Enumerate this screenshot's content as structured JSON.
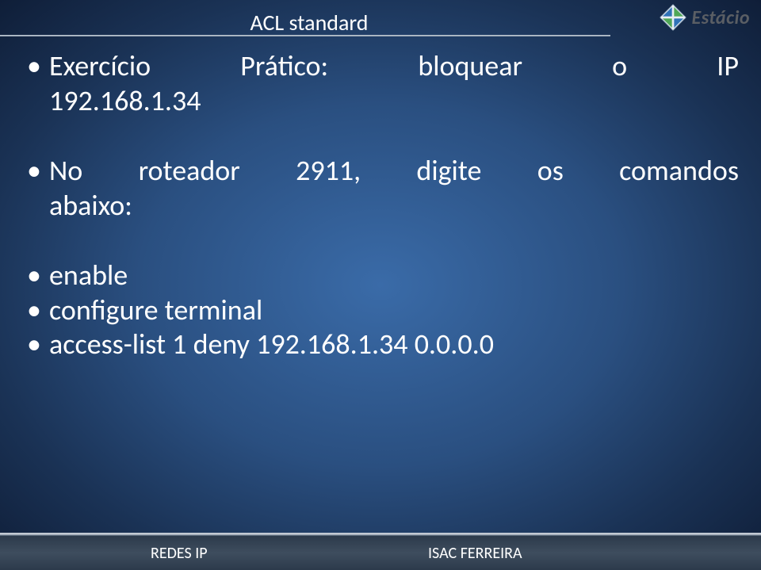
{
  "header": {
    "title": "ACL standard",
    "logo_text": "Estácio"
  },
  "bullets": {
    "ex1_a": "Exercício",
    "ex1_b": "Prático:",
    "ex1_c": "bloquear",
    "ex1_d": "o",
    "ex1_e": "IP",
    "ex1_line2": "192.168.1.34",
    "rot_a": "No",
    "rot_b": "roteador",
    "rot_c": "2911,",
    "rot_d": "digite",
    "rot_e": "os",
    "rot_f": "comandos",
    "rot_line2": "abaixo:",
    "cmd1": "enable",
    "cmd2": "configure terminal",
    "cmd3": "access-list 1 deny 192.168.1.34 0.0.0.0"
  },
  "footer": {
    "left": "REDES IP",
    "right": "ISAC FERREIRA"
  }
}
